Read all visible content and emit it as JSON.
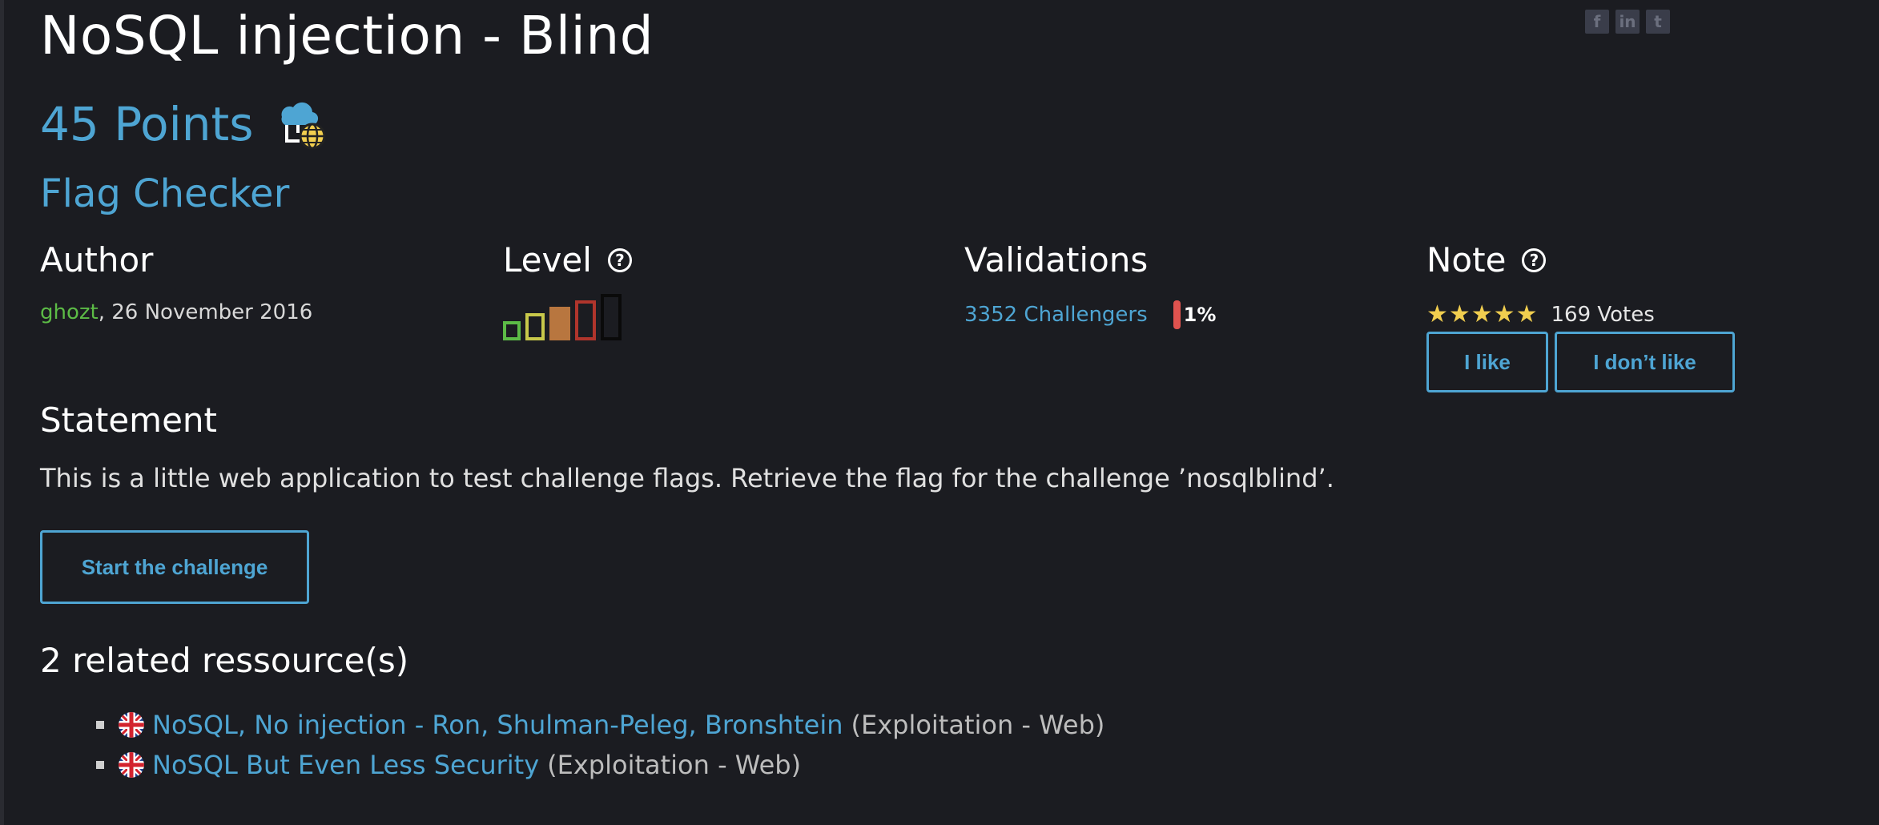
{
  "challenge": {
    "title": "NoSQL injection - Blind",
    "points": "45 Points",
    "category_icon": "web-server-icon",
    "subtitle": "Flag Checker"
  },
  "share": [
    "f",
    "in",
    "t"
  ],
  "author": {
    "heading": "Author",
    "name": "ghozt",
    "date": ",  26 November 2016"
  },
  "level": {
    "heading": "Level",
    "help": "?",
    "value": 3,
    "max": 5,
    "colors": [
      "#5cbb46",
      "#c8c84a",
      "#b8763f",
      "#b0352c",
      "#0a0a0a"
    ]
  },
  "validations": {
    "heading": "Validations",
    "challengers": "3352 Challengers",
    "percent": "1%"
  },
  "note": {
    "heading": "Note",
    "help": "?",
    "stars": "★★★★★",
    "votes": "169 Votes",
    "like": "I like",
    "dislike": "I don’t like"
  },
  "statement": {
    "heading": "Statement",
    "text": "This is a little web application to test challenge flags. Retrieve the flag for the challenge ’nosqlblind’."
  },
  "start_button": "Start the challenge",
  "resources": {
    "heading": "2 related ressource(s)",
    "items": [
      {
        "title": "NoSQL, No injection - Ron, Shulman-Peleg, Bronshtein",
        "category": "(Exploitation - Web)"
      },
      {
        "title": "NoSQL But Even Less Security",
        "category": "(Exploitation - Web)"
      }
    ]
  },
  "colors": {
    "background": "#1b1c21",
    "accent": "#4ea5d3",
    "author": "#5cbb46",
    "stars": "#f1ce4f",
    "percent_bar": "#e0534f"
  }
}
